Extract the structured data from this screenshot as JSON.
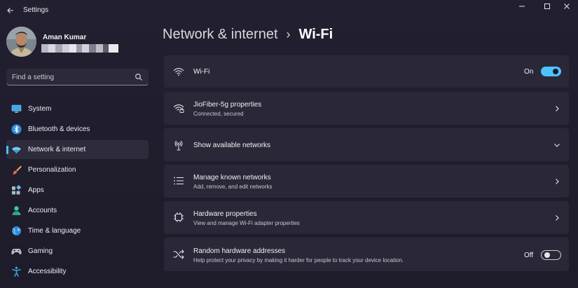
{
  "app": {
    "title": "Settings"
  },
  "user": {
    "name": "Aman Kumar"
  },
  "search": {
    "placeholder": "Find a setting"
  },
  "sidebar": {
    "items": [
      {
        "label": "System",
        "icon": "monitor-icon",
        "active": false
      },
      {
        "label": "Bluetooth & devices",
        "icon": "bluetooth-icon",
        "active": false
      },
      {
        "label": "Network & internet",
        "icon": "wifi-icon",
        "active": true
      },
      {
        "label": "Personalization",
        "icon": "paintbrush-icon",
        "active": false
      },
      {
        "label": "Apps",
        "icon": "apps-icon",
        "active": false
      },
      {
        "label": "Accounts",
        "icon": "person-icon",
        "active": false
      },
      {
        "label": "Time & language",
        "icon": "globe-icon",
        "active": false
      },
      {
        "label": "Gaming",
        "icon": "gamepad-icon",
        "active": false
      },
      {
        "label": "Accessibility",
        "icon": "accessibility-icon",
        "active": false
      }
    ]
  },
  "breadcrumb": {
    "parent": "Network & internet",
    "current": "Wi-Fi"
  },
  "cards": {
    "wifi": {
      "title": "Wi-Fi",
      "toggle_label": "On",
      "toggle_state": true
    },
    "properties": {
      "title": "JioFiber-5g properties",
      "subtitle": "Connected, secured"
    },
    "available": {
      "title": "Show available networks"
    },
    "known": {
      "title": "Manage known networks",
      "subtitle": "Add, remove, and edit networks"
    },
    "hardware": {
      "title": "Hardware properties",
      "subtitle": "View and manage Wi-Fi adapter properties"
    },
    "random": {
      "title": "Random hardware addresses",
      "subtitle": "Help protect your privacy by making it harder for people to track your device location.",
      "toggle_label": "Off",
      "toggle_state": false
    }
  },
  "colors": {
    "accent": "#4cc2ff",
    "background": "#1f1d2b",
    "card": "#2a2838"
  }
}
